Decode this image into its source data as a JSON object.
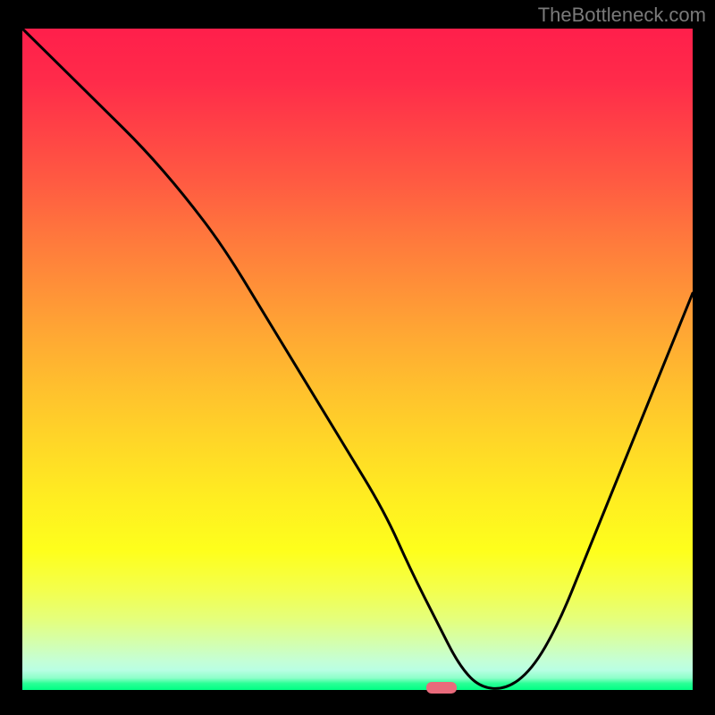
{
  "watermark": "TheBottleneck.com",
  "chart_data": {
    "type": "line",
    "title": "",
    "xlabel": "",
    "ylabel": "",
    "xlim": [
      0,
      100
    ],
    "ylim": [
      0,
      100
    ],
    "x": [
      0,
      6,
      12,
      18,
      24,
      30,
      36,
      42,
      48,
      54,
      58,
      62,
      65,
      68,
      72,
      76,
      80,
      84,
      88,
      92,
      96,
      100
    ],
    "values": [
      100,
      94,
      88,
      82,
      75,
      67,
      57,
      47,
      37,
      27,
      18,
      10,
      4,
      0.5,
      0,
      3,
      10,
      20,
      30,
      40,
      50,
      60
    ],
    "marker": {
      "x": 62.5,
      "y": 0
    },
    "gradient_stops": [
      {
        "pos": 0,
        "color": "#ff1f4b"
      },
      {
        "pos": 50,
        "color": "#ffd020"
      },
      {
        "pos": 100,
        "color": "#00ff84"
      }
    ]
  }
}
